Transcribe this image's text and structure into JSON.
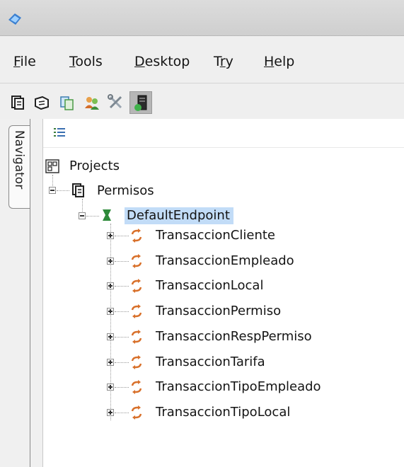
{
  "menu": {
    "items": [
      {
        "mnemonic": "F",
        "rest": "ile"
      },
      {
        "mnemonic": "T",
        "rest": "ools"
      },
      {
        "mnemonic": "D",
        "rest": "esktop"
      },
      {
        "pre": "T",
        "mnemonic": "r",
        "rest": "y"
      },
      {
        "mnemonic": "H",
        "rest": "elp"
      }
    ]
  },
  "toolbar": {
    "buttons": [
      "new-project-icon",
      "open-project-icon",
      "copy-icon",
      "users-icon",
      "tools-icon",
      "server-icon"
    ]
  },
  "navigator": {
    "tab_label": "Navigator",
    "view_icon": "list-view-icon"
  },
  "tree": {
    "root": "Projects",
    "project": "Permisos",
    "endpoint": "DefaultEndpoint",
    "transactions": [
      "TransaccionCliente",
      "TransaccionEmpleado",
      "TransaccionLocal",
      "TransaccionPermiso",
      "TransaccionRespPermiso",
      "TransaccionTarifa",
      "TransaccionTipoEmpleado",
      "TransaccionTipoLocal"
    ]
  },
  "colors": {
    "selection": "#c2dcf7",
    "transaction_icon": "#d8702a",
    "endpoint_icon": "#2e8a3a"
  }
}
